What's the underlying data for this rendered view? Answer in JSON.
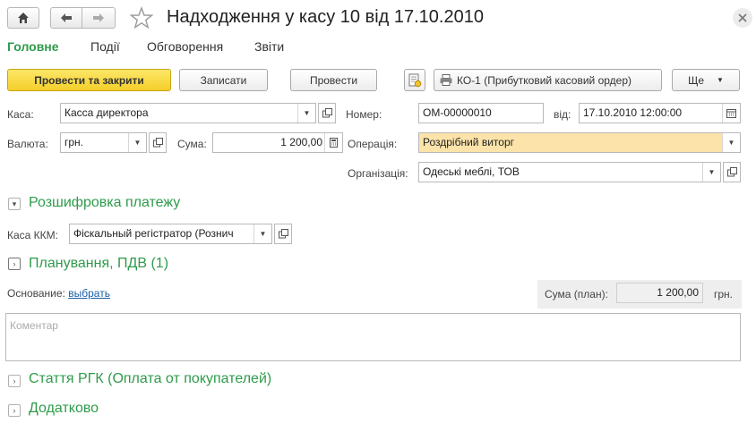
{
  "window": {
    "title": "Надходження у касу 10 від 17.10.2010"
  },
  "tabs": [
    {
      "label": "Головне"
    },
    {
      "label": "Події"
    },
    {
      "label": "Обговорення"
    },
    {
      "label": "Звіти"
    }
  ],
  "toolbar": {
    "post_close": "Провести та закрити",
    "save": "Записати",
    "post": "Провести",
    "ko1": "КО-1 (Прибутковий касовий ордер)",
    "more": "Ще"
  },
  "form": {
    "kasa_label": "Каса:",
    "kasa_value": "Касса директора",
    "number_label": "Номер:",
    "number_value": "ОМ-00000010",
    "date_label": "від:",
    "date_value": "17.10.2010 12:00:00",
    "currency_label": "Валюта:",
    "currency_value": "грн.",
    "sum_label": "Сума:",
    "sum_value": "1 200,00",
    "operation_label": "Операція:",
    "operation_value": "Роздрібний виторг",
    "org_label": "Організація:",
    "org_value": "Одеські меблі, ТОВ"
  },
  "sections": {
    "payment": "Розшифровка платежу",
    "kkm_label": "Каса ККМ:",
    "kkm_value": "Фіскальный регістратор (Рознич",
    "planning": "Планування, ПДВ (1)",
    "basis_label": "Основание:",
    "basis_link": "выбрать",
    "plan_sum_label": "Сума (план):",
    "plan_sum_value": "1 200,00",
    "plan_currency": "грн.",
    "comment_placeholder": "Коментар",
    "rgk": "Стаття РГК (Оплата от покупателей)",
    "extra": "Додатково"
  }
}
